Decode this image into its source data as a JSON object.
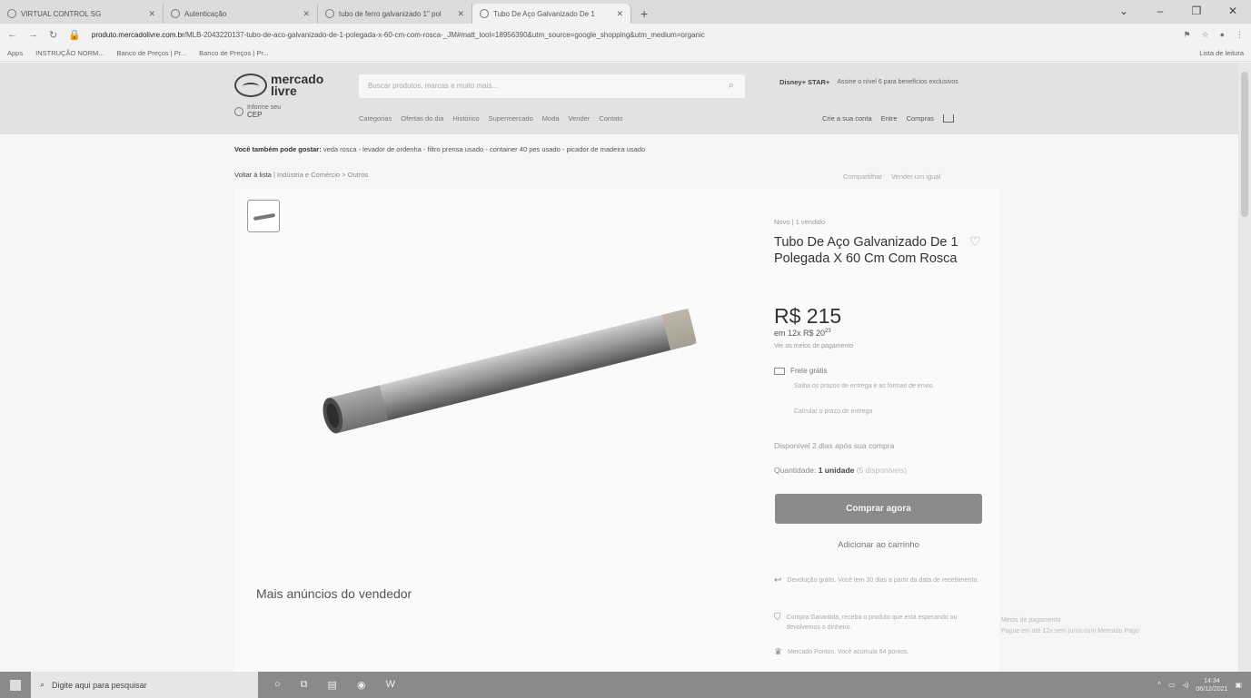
{
  "browser": {
    "tabs": [
      {
        "label": "VIRTUAL CONTROL SG",
        "active": false
      },
      {
        "label": "Autenticação",
        "active": false
      },
      {
        "label": "tubo de ferro galvanizado 1\" pol",
        "active": false
      },
      {
        "label": "Tubo De Aço Galvanizado De 1",
        "active": true
      }
    ],
    "new_tab": "+",
    "url_host": "produto.mercadolivre.com.br",
    "url_path": "/MLB-2043220137-tubo-de-aco-galvanizado-de-1-polegada-x-60-cm-com-rosca-_JM#matt_tool=18956390&utm_source=google_shopping&utm_medium=organic",
    "bookmarks": [
      "Apps",
      "INSTRUÇÃO NORM...",
      "Banco de Preços | Pr...",
      "Banco de Preços | Pr..."
    ],
    "reading_list": "Lista de leitura"
  },
  "site": {
    "logo_line1": "mercado",
    "logo_line2": "livre",
    "search_placeholder": "Buscar produtos, marcas e muito mais...",
    "promo_brand": "Disney+ STAR+",
    "promo_text": "Assine o nível 6 para benefícios exclusivos",
    "cep_label": "Informe seu",
    "cep_value": "CEP",
    "nav": [
      "Categorias",
      "Ofertas do dia",
      "Histórico",
      "Supermercado",
      "Moda",
      "Vender",
      "Contato"
    ],
    "user_links": [
      "Crie a sua conta",
      "Entre",
      "Compras"
    ]
  },
  "suggestions": {
    "prefix": "Você também pode gostar:",
    "items": "veda rosca - levador de ordenha - filtro prensa usado - container 40 pes usado - picador de madeira usado"
  },
  "breadcrumb": {
    "back": "Voltar à lista",
    "path": "Indústria e Comércio > Outros"
  },
  "share_links": [
    "Compartilhar",
    "Vender um igual"
  ],
  "product": {
    "condition": "Novo | 1 vendido",
    "title": "Tubo De Aço Galvanizado De 1 Polegada X 60 Cm Com Rosca",
    "price": "R$ 215",
    "installments": "em 12x R$ 20",
    "installments_cents": "23",
    "payment_link": "Ver os meios de pagamento",
    "shipping_title": "Frete grátis",
    "shipping_sub": "Saiba os prazos de entrega e as formas de envio.",
    "shipping_calc": "Calcular o prazo de entrega",
    "availability": "Disponível 2 dias após sua compra",
    "quantity_label": "Quantidade:",
    "quantity_value": "1 unidade",
    "quantity_left": "(5 disponíveis)",
    "buy_label": "Comprar agora",
    "cart_label": "Adicionar ao carrinho",
    "perks": [
      "Devolução grátis. Você tem 30 dias a partir da data de recebimento.",
      "Compra Garantida, receba o produto que está esperando ou devolvemos o dinheiro.",
      "Mercado Pontos. Você acumula 64 pontos."
    ]
  },
  "more_from_seller": "Mais anúncios do vendedor",
  "seller_side": {
    "line1": "Meios de pagamento",
    "line2": "Pague em até 12x sem juros com Mercado Pago"
  },
  "taskbar": {
    "search_placeholder": "Digite aqui para pesquisar",
    "time": "14:34",
    "date": "06/12/2021"
  },
  "colors": {
    "header_bg": "#e2e2e2",
    "buy_button": "#8a8a8a",
    "taskbar": "#8a8a8a"
  }
}
